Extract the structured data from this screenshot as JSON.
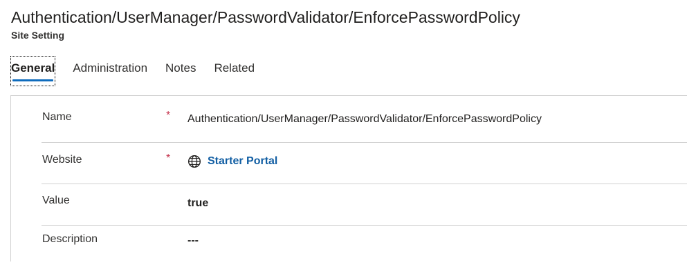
{
  "record": {
    "title": "Authentication/UserManager/PasswordValidator/EnforcePasswordPolicy",
    "entity_type": "Site Setting"
  },
  "tabs": [
    {
      "label": "General",
      "active": true
    },
    {
      "label": "Administration",
      "active": false
    },
    {
      "label": "Notes",
      "active": false
    },
    {
      "label": "Related",
      "active": false
    }
  ],
  "form": {
    "required_marker": "*",
    "fields": {
      "name": {
        "label": "Name",
        "value": "Authentication/UserManager/PasswordValidator/EnforcePasswordPolicy",
        "required": true
      },
      "website": {
        "label": "Website",
        "value": "Starter Portal",
        "required": true,
        "icon": "globe-icon"
      },
      "value": {
        "label": "Value",
        "value": "true",
        "required": false
      },
      "description": {
        "label": "Description",
        "value": "---",
        "required": false
      }
    }
  },
  "colors": {
    "accent": "#0f6cbd",
    "link": "#115ea3",
    "required": "#c4314b",
    "divider": "#d1d1d1"
  }
}
